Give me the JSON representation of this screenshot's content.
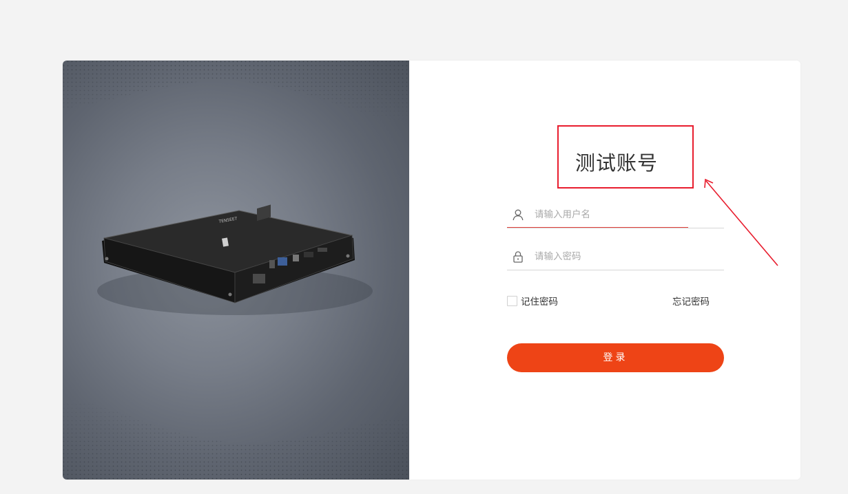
{
  "colors": {
    "page_background": "#f3f3f3",
    "accent": "#ee4416",
    "annotation": "#e81c2d",
    "active_underline": "#e0403a"
  },
  "login": {
    "title": "测试账号",
    "username": {
      "icon": "user-icon",
      "placeholder": "请输入用户名",
      "value": ""
    },
    "password": {
      "icon": "lock-icon",
      "placeholder": "请输入密码",
      "value": ""
    },
    "remember_label": "记住密码",
    "remember_checked": false,
    "forgot_label": "忘记密码",
    "submit_label": "登录"
  },
  "illustration": {
    "device_brand": "TENSEET"
  }
}
